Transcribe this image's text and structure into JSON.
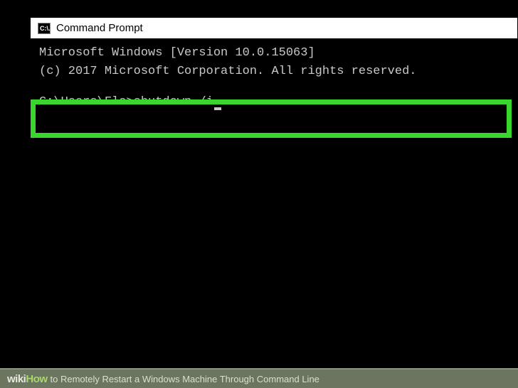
{
  "window": {
    "icon_label": "C:\\.",
    "title": "Command Prompt"
  },
  "console": {
    "line1": "Microsoft Windows [Version 10.0.15063]",
    "line2": "(c) 2017 Microsoft Corporation. All rights reserved.",
    "prompt": "C:\\Users\\Flo>",
    "command": "shutdown /i"
  },
  "caption": {
    "brand_wiki": "wiki",
    "brand_how": "How",
    "text": " to Remotely Restart a Windows Machine Through Command Line"
  },
  "highlight": {
    "color": "#39d62e"
  }
}
